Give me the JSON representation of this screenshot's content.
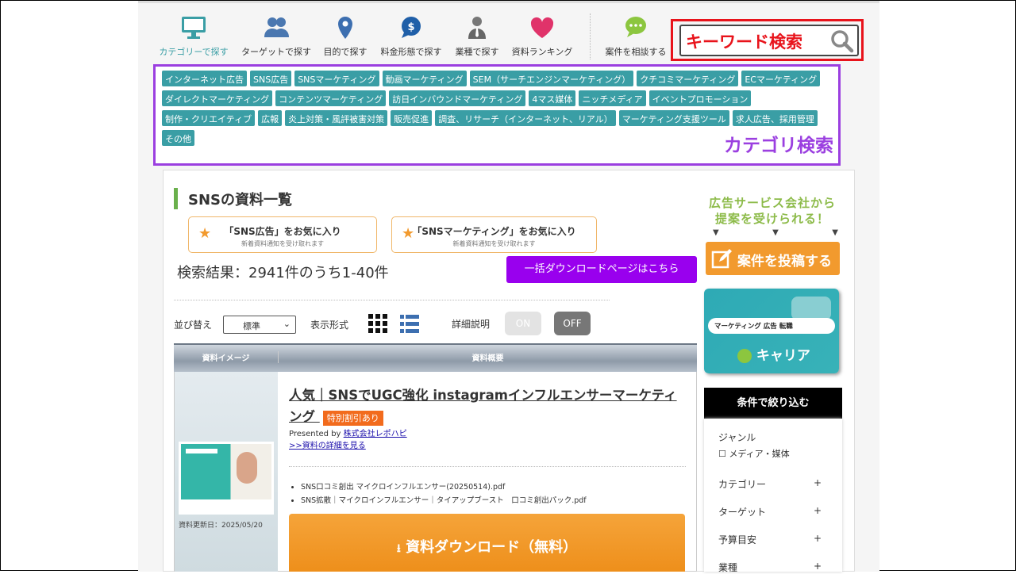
{
  "nav": {
    "items": [
      {
        "label": "カテゴリーで探す",
        "icon": "monitor-icon",
        "active": true
      },
      {
        "label": "ターゲットで探す",
        "icon": "users-icon"
      },
      {
        "label": "目的で探す",
        "icon": "map-pin-icon"
      },
      {
        "label": "料金形態で探す",
        "icon": "dollar-bubble-icon"
      },
      {
        "label": "業種で探す",
        "icon": "businessman-icon"
      },
      {
        "label": "資料ランキング",
        "icon": "heart-icon"
      },
      {
        "label": "案件を相談する",
        "icon": "chat-bubble-icon"
      }
    ],
    "keyword_search": "キーワード検索"
  },
  "categories": {
    "label": "カテゴリ検索",
    "rows": [
      [
        "インターネット広告",
        "SNS広告",
        "SNSマーケティング",
        "動画マーケティング",
        "SEM（サーチエンジンマーケティング）",
        "クチコミマーケティング",
        "ECマーケティング"
      ],
      [
        "ダイレクトマーケティング",
        "コンテンツマーケティング",
        "訪日インバウンドマーケティング",
        "4マス媒体",
        "ニッチメディア",
        "イベントプロモーション"
      ],
      [
        "制作・クリエイティブ",
        "広報",
        "炎上対策・風評被害対策",
        "販売促進",
        "調査、リサーチ（インターネット、リアル）",
        "マーケティング支援ツール",
        "求人広告、採用管理"
      ],
      [
        "その他"
      ]
    ]
  },
  "main": {
    "title": "SNSの資料一覧",
    "favorites": [
      {
        "title": "「SNS広告」をお気に入り",
        "sub": "新着資料通知を受け取れます"
      },
      {
        "title": "「SNSマーケティング」をお気に入り",
        "sub": "新着資料通知を受け取れます"
      }
    ],
    "result": "検索結果：2941件のうち1-40件",
    "bulk_button": "一括ダウンロードページはこちら",
    "sort_label": "並び替え",
    "sort_value": "標準",
    "view_label": "表示形式",
    "detail_label": "詳細説明",
    "on": "ON",
    "off": "OFF",
    "col_image": "資料イメージ",
    "col_summary": "資料概要",
    "item": {
      "title": "人気｜SNSでUGC強化 instagramインフルエンサーマーケティング",
      "badge": "特別割引あり",
      "presented_by": "Presented by ",
      "company": "株式会社レポハピ",
      "detail_link": ">>資料の詳細を見る",
      "updated": "資料更新日：2025/05/20",
      "files": [
        "SNS口コミ創出 マイクロインフルエンサー(20250514).pdf",
        "SNS拡散｜マイクロインフルエンサー｜タイアップブースト　口コミ創出パック.pdf"
      ],
      "download": "資料ダウンロード（無料）"
    }
  },
  "sidebar": {
    "promo_line1": "広告サービス会社から",
    "promo_line2": "提案を受けられる！",
    "post_button": "案件を投稿する",
    "banner_search": "マーケティング 広告 転職",
    "banner_brand": "キャリア",
    "filter_title": "条件で絞り込む",
    "genre": "ジャンル",
    "genre_option": "メディア・媒体",
    "filters": [
      "カテゴリー",
      "ターゲット",
      "予算目安",
      "業種"
    ]
  }
}
